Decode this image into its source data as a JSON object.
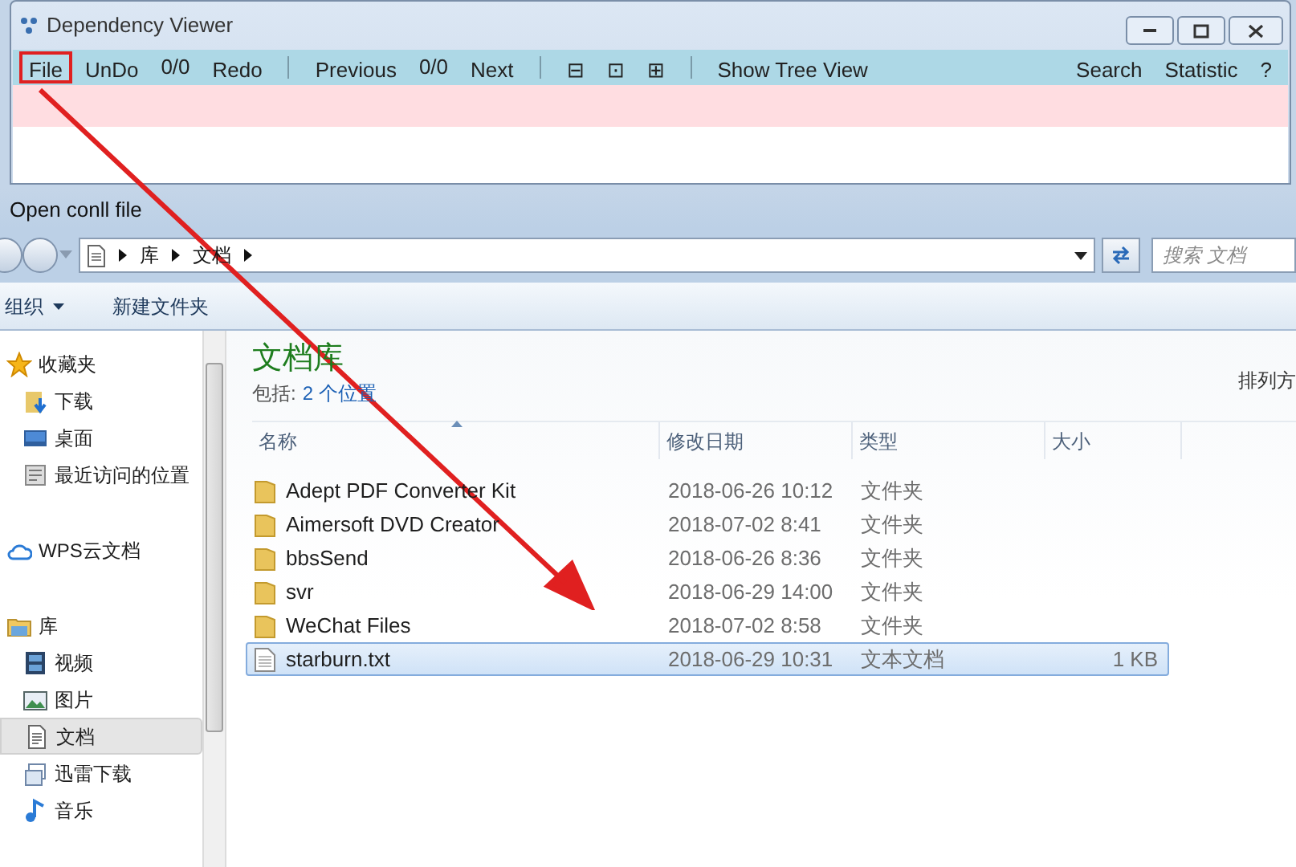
{
  "app_window": {
    "title": "Dependency Viewer",
    "toolbar": [
      {
        "kind": "button",
        "label": "File",
        "highlighted": true
      },
      {
        "kind": "button",
        "label": "UnDo",
        "highlighted": false
      },
      {
        "kind": "text",
        "label": "0/0"
      },
      {
        "kind": "button",
        "label": "Redo",
        "highlighted": false
      },
      {
        "kind": "separator"
      },
      {
        "kind": "button",
        "label": "Previous",
        "highlighted": false
      },
      {
        "kind": "text",
        "label": "0/0"
      },
      {
        "kind": "button",
        "label": "Next",
        "highlighted": false
      },
      {
        "kind": "separator"
      },
      {
        "kind": "button",
        "label": "⊟",
        "highlighted": false
      },
      {
        "kind": "button",
        "label": "⊡",
        "highlighted": false
      },
      {
        "kind": "button",
        "label": "⊞",
        "highlighted": false
      },
      {
        "kind": "separator"
      },
      {
        "kind": "button",
        "label": "Show Tree View",
        "highlighted": false
      },
      {
        "kind": "spacer"
      },
      {
        "kind": "button",
        "label": "Search",
        "highlighted": false
      },
      {
        "kind": "button",
        "label": "Statistic",
        "highlighted": false
      },
      {
        "kind": "button",
        "label": "?",
        "highlighted": false
      }
    ]
  },
  "open_dialog": {
    "title": "Open conll file",
    "breadcrumb": [
      "库",
      "文档"
    ],
    "search": {
      "placeholder": "搜索 文档"
    },
    "commands": [
      {
        "label": "组织",
        "dropdown": true
      },
      {
        "label": "新建文件夹",
        "dropdown": false
      }
    ],
    "sidebar": [
      {
        "label": "收藏夹",
        "kind": "star",
        "selected": false,
        "children": [
          {
            "label": "下载",
            "kind": "download",
            "selected": false
          },
          {
            "label": "桌面",
            "kind": "desktop",
            "selected": false
          },
          {
            "label": "最近访问的位置",
            "kind": "recent",
            "selected": false
          }
        ]
      },
      {
        "label": "WPS云文档",
        "kind": "cloud",
        "selected": false
      },
      {
        "label": "库",
        "kind": "library",
        "selected": false,
        "children": [
          {
            "label": "视频",
            "kind": "video",
            "selected": false
          },
          {
            "label": "图片",
            "kind": "picture",
            "selected": false
          },
          {
            "label": "文档",
            "kind": "document",
            "selected": true
          },
          {
            "label": "迅雷下载",
            "kind": "download-box",
            "selected": false
          },
          {
            "label": "音乐",
            "kind": "music",
            "selected": false
          }
        ]
      }
    ],
    "library_title": "文档库",
    "includes_label": "包括:",
    "includes_link": "2 个位置",
    "arrange_label": "排列方",
    "columns": [
      {
        "label": "名称",
        "sorted": true
      },
      {
        "label": "修改日期",
        "sorted": false
      },
      {
        "label": "类型",
        "sorted": false
      },
      {
        "label": "大小",
        "sorted": false
      }
    ],
    "files": [
      {
        "kind": "folder",
        "name": "Adept PDF Converter Kit",
        "date": "2018-06-26 10:12",
        "type": "文件夹",
        "selected": false
      },
      {
        "kind": "folder",
        "name": "Aimersoft DVD Creator",
        "date": "2018-07-02 8:41",
        "type": "文件夹",
        "selected": false
      },
      {
        "kind": "folder",
        "name": "bbsSend",
        "date": "2018-06-26 8:36",
        "type": "文件夹",
        "selected": false
      },
      {
        "kind": "folder",
        "name": "svr",
        "date": "2018-06-29 14:00",
        "type": "文件夹",
        "selected": false
      },
      {
        "kind": "folder",
        "name": "WeChat Files",
        "date": "2018-07-02 8:58",
        "type": "文件夹",
        "selected": false
      },
      {
        "kind": "file",
        "name": "starburn.txt",
        "date": "2018-06-29 10:31",
        "type": "文本文档",
        "size": "1 KB",
        "selected": true
      }
    ]
  }
}
